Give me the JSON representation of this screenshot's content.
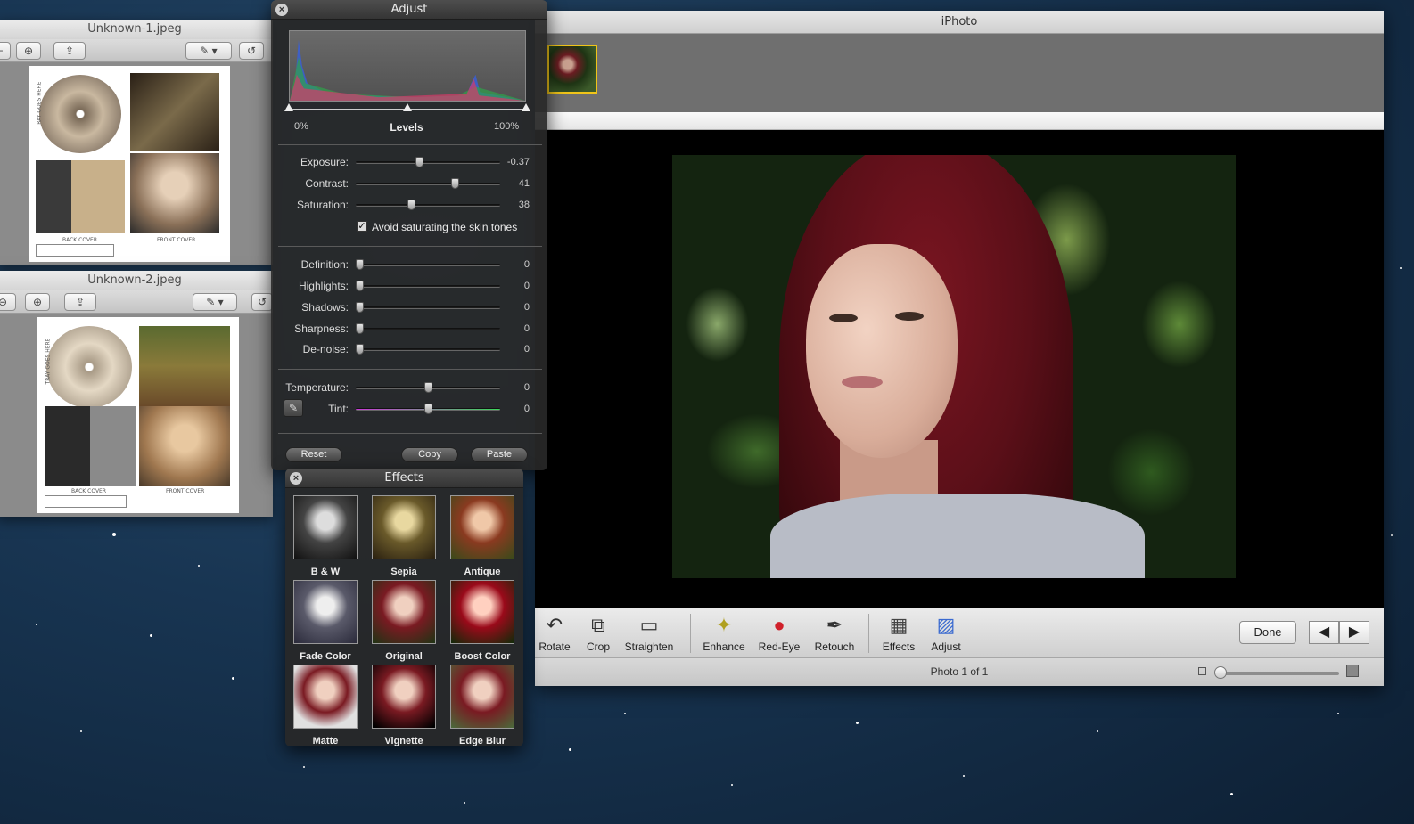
{
  "preview1": {
    "title": "Unknown-1.jpeg",
    "back_cover": "BACK COVER",
    "front_cover": "FRONT COVER",
    "tray": "TRAY GOES HERE"
  },
  "preview2": {
    "title": "Unknown-2.jpeg",
    "back_cover": "BACK COVER",
    "front_cover": "FRONT COVER",
    "tray": "TRAY GOES HERE"
  },
  "iphoto": {
    "title": "iPhoto",
    "tools": [
      {
        "label": "Rotate",
        "icon": "rotate-icon"
      },
      {
        "label": "Crop",
        "icon": "crop-icon"
      },
      {
        "label": "Straighten",
        "icon": "straighten-icon"
      },
      {
        "label": "Enhance",
        "icon": "enhance-icon"
      },
      {
        "label": "Red-Eye",
        "icon": "red-eye-icon"
      },
      {
        "label": "Retouch",
        "icon": "retouch-icon"
      },
      {
        "label": "Effects",
        "icon": "effects-icon"
      },
      {
        "label": "Adjust",
        "icon": "adjust-icon"
      }
    ],
    "done": "Done",
    "status": "Photo 1 of 1"
  },
  "adjust": {
    "title": "Adjust",
    "levels_min": "0%",
    "levels_label": "Levels",
    "levels_max": "100%",
    "sliders": [
      {
        "label": "Exposure:",
        "value": "-0.37",
        "position": 0.44
      },
      {
        "label": "Contrast:",
        "value": "41",
        "position": 0.7
      },
      {
        "label": "Saturation:",
        "value": "38",
        "position": 0.38
      },
      {
        "label": "Definition:",
        "value": "0",
        "position": 0
      },
      {
        "label": "Highlights:",
        "value": "0",
        "position": 0
      },
      {
        "label": "Shadows:",
        "value": "0",
        "position": 0
      },
      {
        "label": "Sharpness:",
        "value": "0",
        "position": 0
      },
      {
        "label": "De-noise:",
        "value": "0",
        "position": 0
      },
      {
        "label": "Temperature:",
        "value": "0",
        "position": 0.5
      },
      {
        "label": "Tint:",
        "value": "0",
        "position": 0.5
      }
    ],
    "avoid_skin": "Avoid saturating the skin tones",
    "reset": "Reset",
    "copy": "Copy",
    "paste": "Paste"
  },
  "effects": {
    "title": "Effects",
    "items": [
      "B & W",
      "Sepia",
      "Antique",
      "Fade Color",
      "Original",
      "Boost Color",
      "Matte",
      "Vignette",
      "Edge Blur"
    ]
  }
}
